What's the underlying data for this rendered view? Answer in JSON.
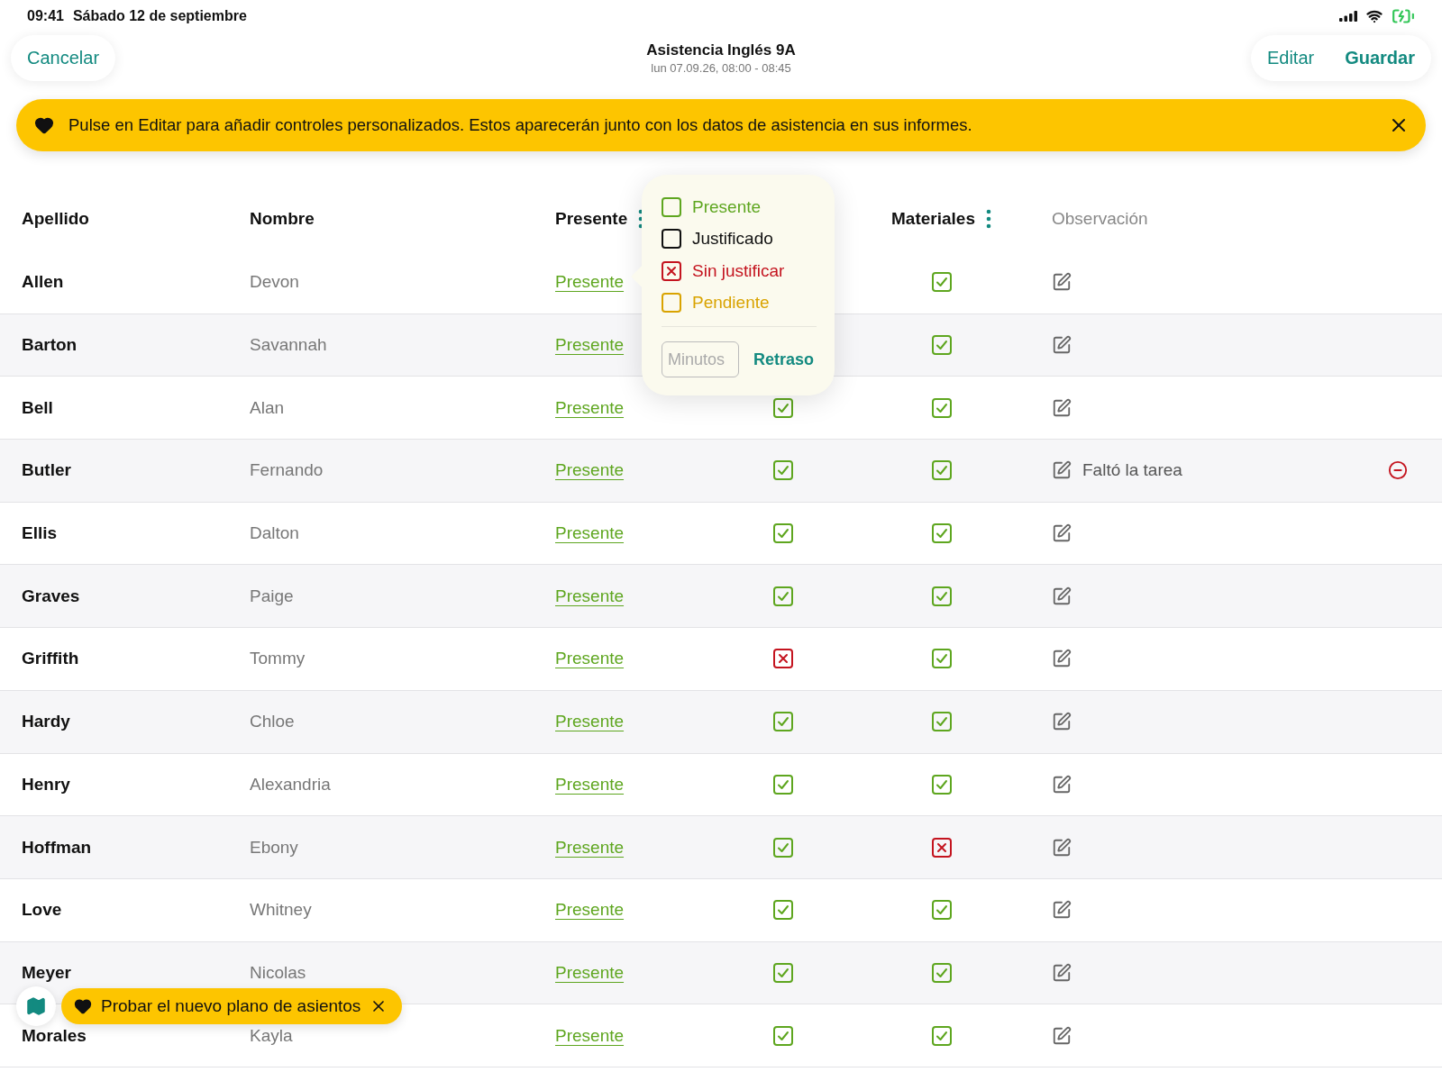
{
  "status_bar": {
    "time": "09:41",
    "date": "Sábado 12 de septiembre"
  },
  "nav": {
    "cancel": "Cancelar",
    "title": "Asistencia Inglés 9A",
    "subtitle": "lun 07.09.26, 08:00 - 08:45",
    "edit": "Editar",
    "save": "Guardar"
  },
  "banner": {
    "text": "Pulse en Editar para añadir controles personalizados. Estos aparecerán junto con los datos de asistencia en sus informes."
  },
  "table": {
    "columns": [
      {
        "label": "Apellido",
        "kind": "plain"
      },
      {
        "label": "Nombre",
        "kind": "plain"
      },
      {
        "label": "Presente",
        "kind": "menu"
      },
      {
        "label": "Materiales",
        "kind": "menu"
      },
      {
        "label": "Observación",
        "kind": "muted"
      }
    ],
    "rows": [
      {
        "last": "Allen",
        "first": "Devon",
        "status": "Presente",
        "materiales_checked": true
      },
      {
        "last": "Barton",
        "first": "Savannah",
        "status": "Presente",
        "materiales_checked": true
      },
      {
        "last": "Bell",
        "first": "Alan",
        "status": "Presente",
        "column_4_checked": true,
        "materiales_checked": true
      },
      {
        "last": "Butler",
        "first": "Fernando",
        "status": "Presente",
        "column_4_checked": true,
        "materiales_checked": true,
        "note": "Faltó la tarea"
      },
      {
        "last": "Ellis",
        "first": "Dalton",
        "status": "Presente",
        "column_4_checked": true,
        "materiales_checked": true
      },
      {
        "last": "Graves",
        "first": "Paige",
        "status": "Presente",
        "column_4_checked": true,
        "materiales_checked": true
      },
      {
        "last": "Griffith",
        "first": "Tommy",
        "status": "Presente",
        "column_4_checked": false,
        "materiales_checked": true
      },
      {
        "last": "Hardy",
        "first": "Chloe",
        "status": "Presente",
        "column_4_checked": true,
        "materiales_checked": true
      },
      {
        "last": "Henry",
        "first": "Alexandria",
        "status": "Presente",
        "column_4_checked": true,
        "materiales_checked": true
      },
      {
        "last": "Hoffman",
        "first": "Ebony",
        "status": "Presente",
        "column_4_checked": true,
        "materiales_checked": false
      },
      {
        "last": "Love",
        "first": "Whitney",
        "status": "Presente",
        "column_4_checked": true,
        "materiales_checked": true
      },
      {
        "last": "Meyer",
        "first": "Nicolas",
        "status": "Presente",
        "column_4_checked": true,
        "materiales_checked": true
      },
      {
        "last": "Morales",
        "first": "Kayla",
        "status": "Presente",
        "column_4_checked": true,
        "materiales_checked": true
      }
    ]
  },
  "popover": {
    "options": [
      {
        "label": "Presente",
        "color": "#5ea61f",
        "checked": false
      },
      {
        "label": "Justificado",
        "color": "#111111",
        "checked": false
      },
      {
        "label": "Sin justificar",
        "color": "#c4141f",
        "checked": true
      },
      {
        "label": "Pendiente",
        "color": "#d9a300",
        "checked": false
      }
    ],
    "minutes_placeholder": "Minutos",
    "delay": "Retraso"
  },
  "toast": {
    "text": "Probar el nuevo plano de asientos"
  }
}
